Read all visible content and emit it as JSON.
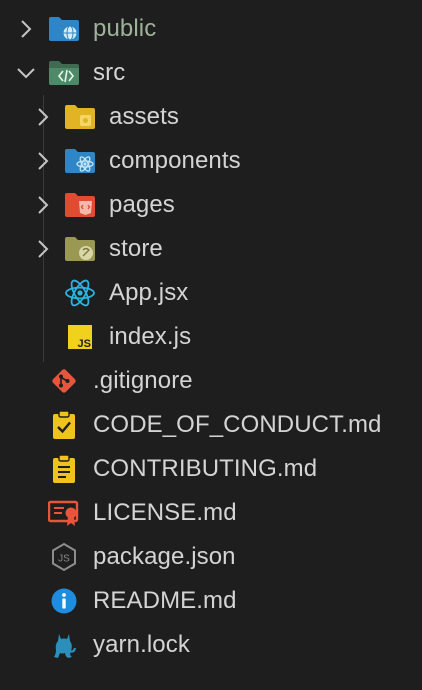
{
  "tree": {
    "public": {
      "label": "public",
      "icon": "folder-public-icon",
      "state": "collapsed"
    },
    "src": {
      "label": "src",
      "icon": "folder-src-icon",
      "state": "expanded"
    },
    "assets": {
      "label": "assets",
      "icon": "folder-assets-icon",
      "state": "collapsed"
    },
    "components": {
      "label": "components",
      "icon": "folder-components-icon",
      "state": "collapsed"
    },
    "pages": {
      "label": "pages",
      "icon": "folder-pages-icon",
      "state": "collapsed"
    },
    "store": {
      "label": "store",
      "icon": "folder-store-icon",
      "state": "collapsed"
    },
    "app_jsx": {
      "label": "App.jsx",
      "icon": "react-icon"
    },
    "index_js": {
      "label": "index.js",
      "icon": "js-icon"
    },
    "gitignore": {
      "label": ".gitignore",
      "icon": "git-icon"
    },
    "code_of_conduct": {
      "label": "CODE_OF_CONDUCT.md",
      "icon": "clipboard-check-icon"
    },
    "contributing": {
      "label": "CONTRIBUTING.md",
      "icon": "clipboard-list-icon"
    },
    "license": {
      "label": "LICENSE.md",
      "icon": "certificate-icon"
    },
    "package_json": {
      "label": "package.json",
      "icon": "nodejs-icon"
    },
    "readme": {
      "label": "README.md",
      "icon": "info-icon"
    },
    "yarn_lock": {
      "label": "yarn.lock",
      "icon": "yarn-cat-icon"
    }
  },
  "colors": {
    "background": "#1e1e1e",
    "text": "#d4d4d4",
    "folder_blue": "#4aa8e0",
    "folder_yellow": "#f2c230",
    "folder_red": "#e8553d",
    "folder_olive": "#a6a35a",
    "folder_src": "#4e7c60",
    "react": "#27b6e3",
    "js": "#f0d21c",
    "git": "#e8553d",
    "info": "#1e8de0"
  }
}
